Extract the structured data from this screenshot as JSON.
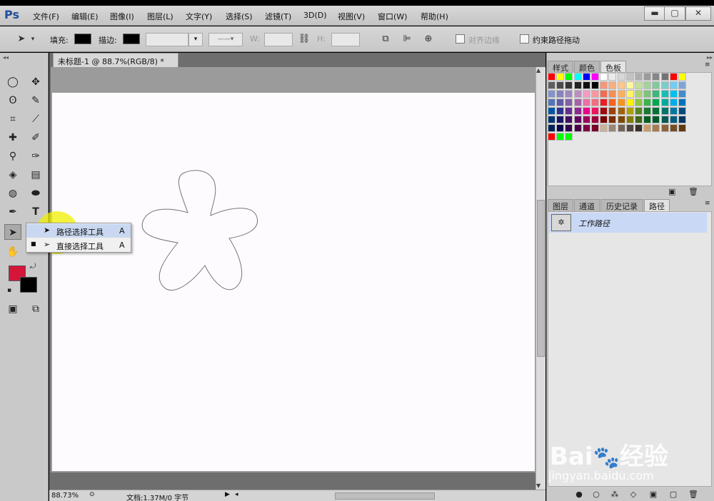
{
  "app": {
    "logo": "Ps"
  },
  "menu": [
    "文件(F)",
    "编辑(E)",
    "图像(I)",
    "图层(L)",
    "文字(Y)",
    "选择(S)",
    "滤镜(T)",
    "3D(D)",
    "视图(V)",
    "窗口(W)",
    "帮助(H)"
  ],
  "window_buttons": {
    "min": "▬",
    "restore": "▢",
    "close": "✕"
  },
  "options": {
    "fill_label": "填充:",
    "stroke_label": "描边:",
    "w_label": "W:",
    "h_label": "H:",
    "align_edges_label": "对齐边缘",
    "constrain_label": "约束路径拖动",
    "fill_color": "#000000",
    "stroke_color": "#000000"
  },
  "document": {
    "tab_title": "未标题-1 @ 88.7%(RGB/8) *",
    "tab_close": "×",
    "zoom": "88.73%",
    "doc_info": "文档:1.37M/0 字节"
  },
  "flyout": {
    "items": [
      {
        "label": "路径选择工具",
        "shortcut": "A"
      },
      {
        "label": "直接选择工具",
        "shortcut": "A"
      }
    ]
  },
  "colors": {
    "foreground": "#d4163a",
    "background": "#000000"
  },
  "panels": {
    "top_tabs": [
      "样式",
      "颜色",
      "色板"
    ],
    "bottom_tabs": [
      "图层",
      "通道",
      "历史记录",
      "路径"
    ],
    "path_item": "工作路径"
  },
  "swatches": [
    "#ff0000",
    "#ffff00",
    "#00ff00",
    "#00ffff",
    "#0000ff",
    "#ff00ff",
    "#ffffff",
    "#ebebeb",
    "#d7d7d7",
    "#c3c3c3",
    "#afafaf",
    "#9b9b9b",
    "#878787",
    "#737373",
    "#ff0000",
    "#ffff00",
    "#5f5f5f",
    "#4b4b4b",
    "#373737",
    "#232323",
    "#0f0f0f",
    "#000000",
    "#f7977a",
    "#f9ad81",
    "#fdc68a",
    "#fff79a",
    "#c4df9b",
    "#a3d39c",
    "#82ca9d",
    "#7bcdc8",
    "#6ecff6",
    "#7ea7d8",
    "#8493ca",
    "#8882be",
    "#a187be",
    "#bc8dbf",
    "#f49ac2",
    "#f6989d",
    "#f26c4f",
    "#f68e55",
    "#fbaf5c",
    "#fff467",
    "#acd372",
    "#7cc576",
    "#3bb878",
    "#1abbb4",
    "#00bff3",
    "#438ccb",
    "#5574b9",
    "#605ca8",
    "#855fa8",
    "#a763a8",
    "#f06ea9",
    "#f26d7d",
    "#ed1c24",
    "#f26522",
    "#f7941d",
    "#fff200",
    "#8dc63f",
    "#39b54a",
    "#00a651",
    "#00a99d",
    "#00aeef",
    "#0072bc",
    "#0054a6",
    "#2e3192",
    "#662d91",
    "#92278f",
    "#ec008c",
    "#ed145b",
    "#9e0b0f",
    "#a0410d",
    "#a3620a",
    "#aba000",
    "#598527",
    "#1a7b30",
    "#007236",
    "#00746b",
    "#0076a3",
    "#004b80",
    "#003471",
    "#1b1464",
    "#440e62",
    "#630460",
    "#9e005d",
    "#9e0039",
    "#790000",
    "#7b2e00",
    "#7d4900",
    "#827b00",
    "#406618",
    "#005e20",
    "#005826",
    "#005952",
    "#005b7f",
    "#003663",
    "#002157",
    "#0d004c",
    "#32004b",
    "#4b0049",
    "#7b0046",
    "#7a0026",
    "#c7b299",
    "#998675",
    "#736357",
    "#534741",
    "#37302a",
    "#c69c6d",
    "#a67c52",
    "#8c6239",
    "#754c24",
    "#603913",
    "#ff0000",
    "#00ff00",
    "#00ff00"
  ]
}
